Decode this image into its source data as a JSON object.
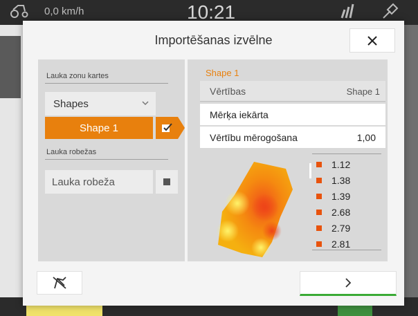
{
  "status": {
    "speed": "0,0 km/h",
    "time": "10:21"
  },
  "dialog": {
    "title": "Importēšanas izvēlne",
    "left": {
      "zone_maps_label": "Lauka zonu kartes",
      "select_value": "Shapes",
      "selected_item": "Shape 1",
      "boundaries_label": "Lauka robežas",
      "boundary_item": "Lauka robeža"
    },
    "right": {
      "heading": "Shape 1",
      "values_label": "Vērtības",
      "values_value": "Shape 1",
      "target_label": "Mērķa iekārta",
      "scaling_label": "Vērtību mērogošana",
      "scaling_value": "1,00",
      "legend": [
        {
          "label": "1.12",
          "color": "#e8530d"
        },
        {
          "label": "1.38",
          "color": "#e8530d"
        },
        {
          "label": "1.39",
          "color": "#e8530d"
        },
        {
          "label": "2.68",
          "color": "#e8530d"
        },
        {
          "label": "2.79",
          "color": "#e8530d"
        },
        {
          "label": "2.81",
          "color": "#e8530d"
        }
      ]
    }
  },
  "colors": {
    "accent": "#e8800d",
    "confirm": "#3aaa35"
  },
  "icons": {
    "close": "close-icon",
    "checkbox": "checkmark-icon",
    "chevron": "chevron-down-icon",
    "footer_left": "no-section-control-icon",
    "next": "chevron-right-icon"
  }
}
